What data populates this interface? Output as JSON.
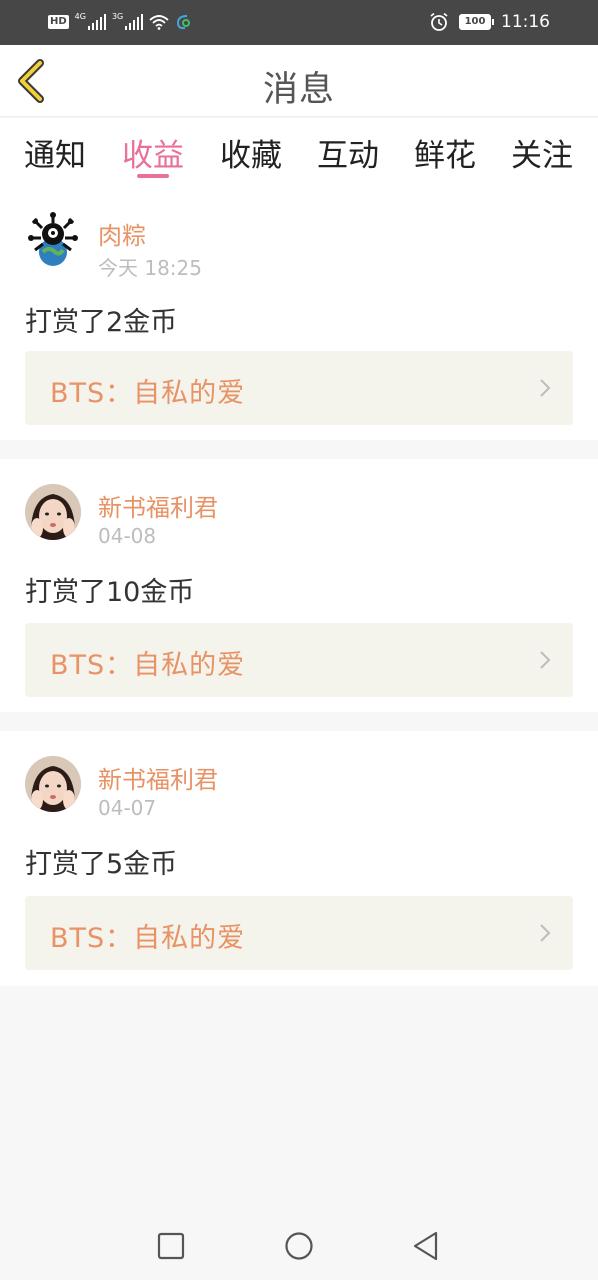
{
  "status_bar": {
    "hd": "HD",
    "net1": "4G",
    "net2": "3G",
    "battery": "100",
    "time": "11:16",
    "icons": [
      "hd-icon",
      "signal-icon",
      "wifi-icon",
      "app-icon",
      "alarm-icon",
      "battery-icon"
    ]
  },
  "header": {
    "title": "消息",
    "back_icon": "back-chevron-icon"
  },
  "tabs": [
    {
      "label": "通知",
      "active": false
    },
    {
      "label": "收益",
      "active": true
    },
    {
      "label": "收藏",
      "active": false
    },
    {
      "label": "互动",
      "active": false
    },
    {
      "label": "鲜花",
      "active": false
    },
    {
      "label": "关注",
      "active": false
    }
  ],
  "notifications": [
    {
      "user": "肉粽",
      "time": "今天 18:25",
      "message": "打赏了2金币",
      "book": "BTS：自私的爱"
    },
    {
      "user": "新书福利君",
      "time": "04-08",
      "message": "打赏了10金币",
      "book": "BTS：自私的爱"
    },
    {
      "user": "新书福利君",
      "time": "04-07",
      "message": "打赏了5金币",
      "book": "BTS：自私的爱"
    }
  ],
  "colors": {
    "accent": "#e8719a",
    "name": "#e89265",
    "link_bg": "#f4f3ec"
  },
  "nav_icons": [
    "recents-square-icon",
    "home-circle-icon",
    "back-triangle-icon"
  ]
}
